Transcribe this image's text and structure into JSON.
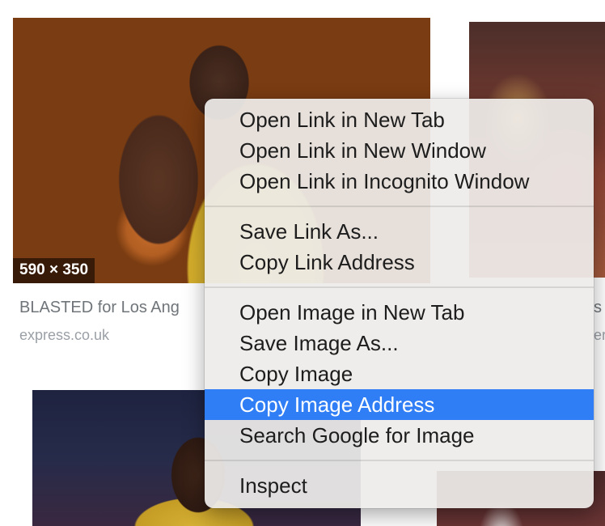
{
  "results": [
    {
      "dimensions": "590 × 350",
      "caption": "BLASTED for Los Ang",
      "source": "express.co.uk"
    },
    {
      "caption": "s",
      "source": "er."
    },
    {},
    {}
  ],
  "context_menu": {
    "groups": [
      [
        "Open Link in New Tab",
        "Open Link in New Window",
        "Open Link in Incognito Window"
      ],
      [
        "Save Link As...",
        "Copy Link Address"
      ],
      [
        "Open Image in New Tab",
        "Save Image As...",
        "Copy Image",
        "Copy Image Address",
        "Search Google for Image"
      ],
      [
        "Inspect"
      ]
    ],
    "highlighted": "Copy Image Address"
  },
  "colors": {
    "menu_highlight": "#2f7ef6",
    "caption_text": "#70757a",
    "source_text": "#9aa0a6"
  }
}
